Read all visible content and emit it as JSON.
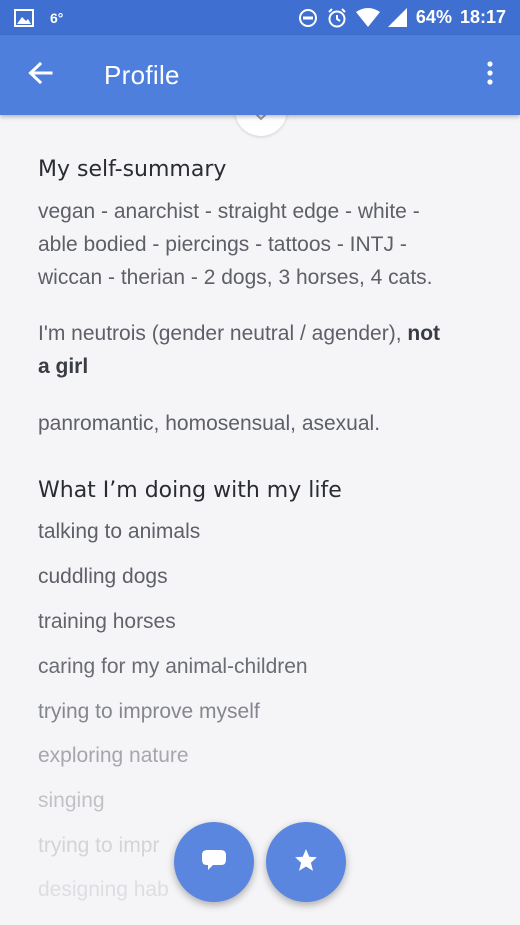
{
  "status_bar": {
    "temperature": "6°",
    "battery": "64%",
    "time": "18:17"
  },
  "toolbar": {
    "title": "Profile"
  },
  "summary": {
    "heading": "My self-summary",
    "line1": "vegan - anarchist - straight edge - white -",
    "line2": "able bodied - piercings - tattoos - INTJ -",
    "line3": "wiccan - therian - 2 dogs, 3 horses, 4 cats.",
    "gender_line1": "I'm neutrois (gender neutral / agender),",
    "gender_bold1": "not",
    "gender_bold2": "a girl",
    "orientation": "panromantic, homosensual, asexual."
  },
  "life": {
    "heading": "What I’m doing with my life",
    "items": [
      "talking to animals",
      "cuddling dogs",
      "training horses",
      "caring for my animal-children",
      "trying to improve myself",
      "exploring nature",
      "singing",
      "trying to impr",
      "designing hab"
    ]
  },
  "colors": {
    "status_bar": "#3f6fd0",
    "toolbar": "#4f7fdc",
    "fab": "#5b86e0"
  },
  "icons": {
    "back": "arrow-back-icon",
    "menu": "more-vert-icon",
    "chat": "chat-bubble-icon",
    "star": "star-icon"
  }
}
